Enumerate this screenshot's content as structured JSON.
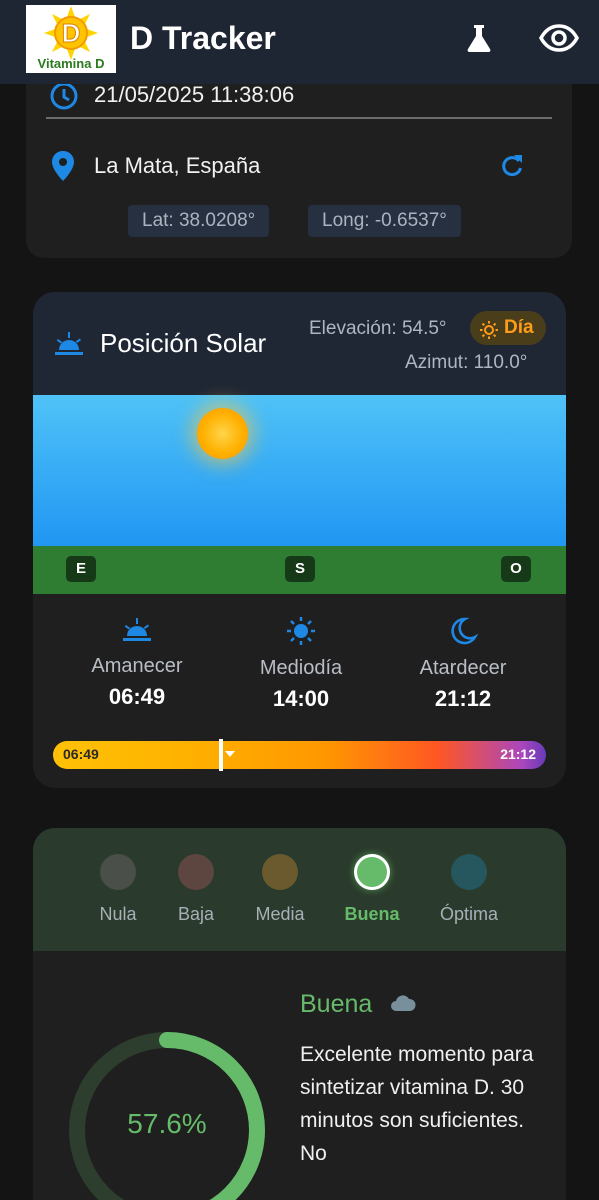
{
  "app": {
    "title": "D Tracker",
    "logo_text": "Vitamina D",
    "logo_letter": "D"
  },
  "datetime": "21/05/2025 11:38:06",
  "location": {
    "name": "La Mata, España",
    "lat": "Lat: 38.0208°",
    "long": "Long: -0.6537°"
  },
  "solar": {
    "title": "Posición Solar",
    "elevation": "Elevación: 54.5°",
    "azimuth": "Azimut: 110.0°",
    "badge": "Día",
    "directions": [
      "E",
      "S",
      "O"
    ],
    "sunrise_label": "Amanecer",
    "sunrise": "06:49",
    "noon_label": "Mediodía",
    "noon": "14:00",
    "sunset_label": "Atardecer",
    "sunset": "21:12",
    "bar_start": "06:49",
    "bar_end": "21:12",
    "day_progress": 0.34
  },
  "quality": {
    "levels": [
      {
        "name": "Nula",
        "color": "#4a5049"
      },
      {
        "name": "Baja",
        "color": "#5d4540"
      },
      {
        "name": "Media",
        "color": "#6a5a2e"
      },
      {
        "name": "Buena",
        "color": "#66bb6a"
      },
      {
        "name": "Óptima",
        "color": "#26575e"
      }
    ],
    "selected": "Buena",
    "title": "Buena",
    "description": "Excelente momento para sintetizar vitamina D. 30 minutos son suficientes. No",
    "percent_text": "57.6%",
    "percent": 57.6
  },
  "colors": {
    "accent_blue": "#1e88e5",
    "good_green": "#66bb6a",
    "orange": "#ff9d1a"
  }
}
